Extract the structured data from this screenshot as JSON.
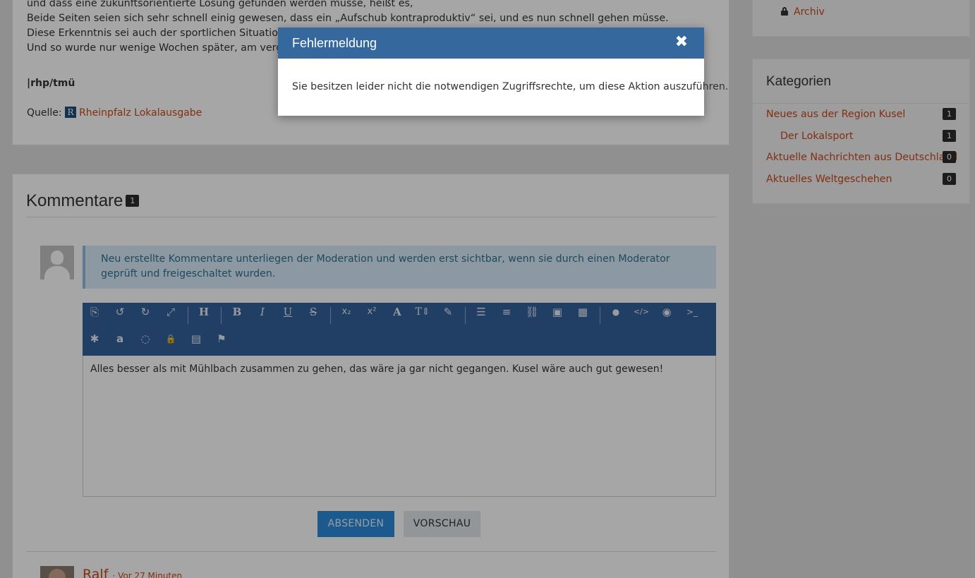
{
  "article": {
    "lines": [
      "und dass eine zukunftsorientierte Lösung gefunden werden müsse, heißt es,",
      "Beide Seiten seien sich sehr schnell einig gewesen, dass ein „Aufschub kontraproduktiv“ sei, und es nun schnell gehen müsse.",
      "Diese Erkenntnis sei auch der sportlichen Situation bei",
      "Und so wurde nur wenige Wochen später, am vergangen"
    ],
    "signature": "|rhp/tmü",
    "source_label": "Quelle:",
    "source_logo_letter": "R",
    "source_link": "Rheinpfalz Lokalausgabe"
  },
  "comments": {
    "title": "Kommentare",
    "count": "1",
    "moderation_notice": "Neu erstellte Kommentare unterliegen der Moderation und werden erst sichtbar, wenn sie durch einen Moderator geprüft und freigeschaltet wurden.",
    "editor_text": "Alles besser als mit Mühlbach zusammen zu gehen, das wäre ja gar nicht gegangen.  Kusel wäre auch gut gewesen!",
    "submit_label": "ABSENDEN",
    "preview_label": "VORSCHAU",
    "first_comment": {
      "author": "Ralf",
      "time": "· Vor 27 Minuten"
    },
    "toolbar_icons": [
      "source-icon",
      "undo-icon",
      "redo-icon",
      "fullscreen-icon",
      "heading-icon",
      "bold-icon",
      "italic-icon",
      "underline-icon",
      "strikethrough-icon",
      "subscript-icon",
      "superscript-icon",
      "font-color-icon",
      "font-size-icon",
      "paint-brush-icon",
      "list-icon",
      "align-icon",
      "link-icon",
      "image-icon",
      "table-icon",
      "quote-icon",
      "code-icon",
      "spoiler-icon",
      "terminal-icon",
      "bug-icon",
      "amazon-icon",
      "hide-icon",
      "lock-icon",
      "news-icon",
      "flag-icon"
    ],
    "toolbar_glyphs": {
      "source": "⎘",
      "undo": "↺",
      "redo": "↻",
      "fullscreen": "⤢",
      "heading": "H",
      "bold": "B",
      "italic": "I",
      "underline": "U",
      "strike": "S",
      "subscript": "x₂",
      "superscript": "x²",
      "font_color": "A",
      "font_size": "T⇕",
      "brush": "✎",
      "list": "☰",
      "align": "≡",
      "link": "⛓",
      "image": "▣",
      "table": "▦",
      "quote": "●",
      "code": "</>",
      "spoiler": "◉",
      "terminal": ">_",
      "bug": "✱",
      "amazon": "a",
      "hide": "◌",
      "lock": "🔒",
      "news": "▤",
      "flag": "⚑"
    }
  },
  "sidebar": {
    "archive_label": "Archiv",
    "categories_title": "Kategorien",
    "categories": [
      {
        "label": "Neues aus der Region Kusel",
        "count": "1"
      },
      {
        "label": "Der Lokalsport",
        "count": "1"
      },
      {
        "label": "Aktuelle Nachrichten aus Deutschland",
        "count": "0"
      },
      {
        "label": "Aktuelles Weltgeschehen",
        "count": "0"
      }
    ]
  },
  "modal": {
    "title": "Fehlermeldung",
    "close_glyph": "✖",
    "message": "Sie besitzen leider nicht die notwendigen Zugriffsrechte, um diese Aktion auszuführen."
  },
  "colors": {
    "link": "#c8481a",
    "modal_header": "#35689d",
    "toolbar": "#33609a",
    "submit": "#2b8ad9"
  }
}
